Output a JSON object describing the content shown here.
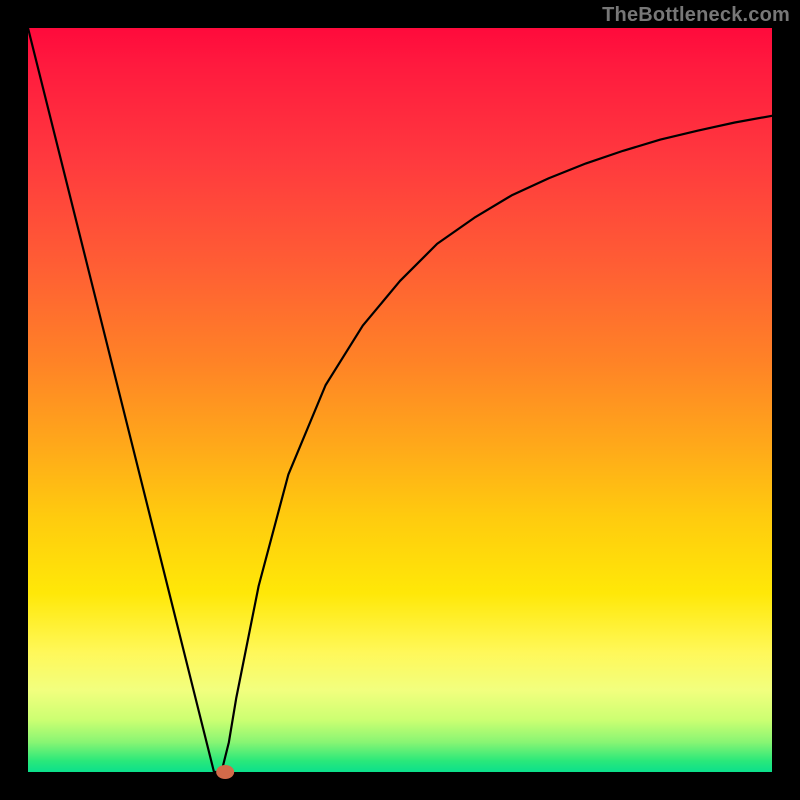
{
  "watermark": "TheBottleneck.com",
  "chart_data": {
    "type": "line",
    "title": "",
    "xlabel": "",
    "ylabel": "",
    "xlim": [
      0,
      100
    ],
    "ylim": [
      0,
      100
    ],
    "grid": false,
    "legend": false,
    "series": [
      {
        "name": "bottleneck-curve",
        "x": [
          0,
          2,
          5,
          8,
          11,
          14,
          17,
          20,
          23,
          25,
          25.5,
          26,
          27,
          28,
          31,
          35,
          40,
          45,
          50,
          55,
          60,
          65,
          70,
          75,
          80,
          85,
          90,
          95,
          100
        ],
        "y": [
          100.0,
          92.0,
          80.0,
          68.0,
          56.0,
          44.0,
          32.0,
          20.0,
          8.0,
          0.0,
          0.0,
          0.0,
          4.0,
          10.0,
          25.0,
          40.0,
          52.0,
          60.0,
          66.0,
          71.0,
          74.5,
          77.5,
          79.8,
          81.8,
          83.5,
          85.0,
          86.2,
          87.3,
          88.2
        ],
        "color": "#000000"
      }
    ],
    "marker": {
      "name": "optimal-point",
      "x": 26.5,
      "y": 0,
      "color": "#d26a4a",
      "rx": 9,
      "ry": 7
    },
    "background_gradient": {
      "orientation": "vertical",
      "stops": [
        {
          "pos": 0.0,
          "color": "#ff0a3c"
        },
        {
          "pos": 0.3,
          "color": "#ff5a34"
        },
        {
          "pos": 0.55,
          "color": "#ffa81a"
        },
        {
          "pos": 0.78,
          "color": "#ffe808"
        },
        {
          "pos": 0.9,
          "color": "#f2ff7e"
        },
        {
          "pos": 0.97,
          "color": "#70f573"
        },
        {
          "pos": 1.0,
          "color": "#0be08c"
        }
      ]
    }
  }
}
